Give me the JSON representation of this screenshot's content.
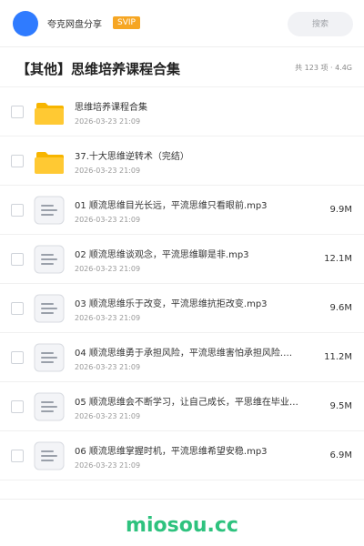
{
  "header": {
    "site_name": "夸克网盘分享",
    "badge": "SVIP",
    "search_placeholder": "搜索",
    "accent": "#2f7bff",
    "badge_color": "#f6a623"
  },
  "share": {
    "title": "【其他】思维培养课程合集",
    "meta": "共 123 项 · 4.4G"
  },
  "files": [
    {
      "type": "folder",
      "name": "思维培养课程合集",
      "date": "2026-03-23 21:09",
      "size": ""
    },
    {
      "type": "folder",
      "name": "37.十大思维逆转术（完结）",
      "date": "2026-03-23 21:09",
      "size": ""
    },
    {
      "type": "file",
      "name": "01 顺流思维目光长远，平流思维只看眼前.mp3",
      "date": "2026-03-23 21:09",
      "size": "9.9M"
    },
    {
      "type": "file",
      "name": "02 顺流思维谈观念，平流思维聊是非.mp3",
      "date": "2026-03-23 21:09",
      "size": "12.1M"
    },
    {
      "type": "file",
      "name": "03 顺流思维乐于改变，平流思维抗拒改变.mp3",
      "date": "2026-03-23 21:09",
      "size": "9.6M"
    },
    {
      "type": "file",
      "name": "04 顺流思维勇于承担风险，平流思维害怕承担风险.…",
      "date": "2026-03-23 21:09",
      "size": "11.2M"
    },
    {
      "type": "file",
      "name": "05 顺流思维会不断学习，让自己成长，平思维在毕业…",
      "date": "2026-03-23 21:09",
      "size": "9.5M"
    },
    {
      "type": "file",
      "name": "06 顺流思维掌握时机，平流思维希望安稳.mp3",
      "date": "2026-03-23 21:09",
      "size": "6.9M"
    }
  ],
  "footer": {
    "brand": "miosou.cc",
    "brand_color": "#2ec27e"
  }
}
